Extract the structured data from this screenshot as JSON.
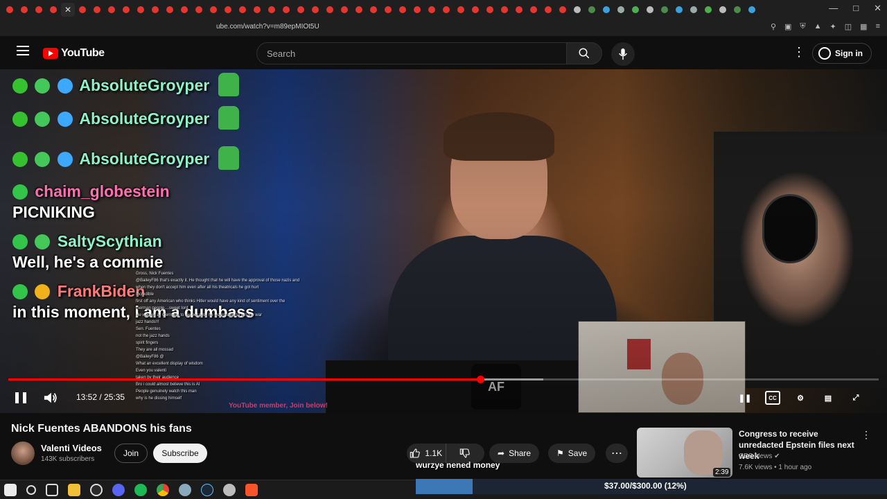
{
  "browser": {
    "url": "ube.com/watch?v=m89epMIOt5U"
  },
  "header": {
    "logo_text": "YouTube",
    "search_placeholder": "Search",
    "sign_in_label": "Sign in"
  },
  "chat": {
    "messages": [
      {
        "user": "AbsoluteGroyper",
        "text": ""
      },
      {
        "user": "AbsoluteGroyper",
        "text": ""
      },
      {
        "user": "AbsoluteGroyper",
        "text": ""
      },
      {
        "user": "chaim_globestein",
        "text": "PICNIKING"
      },
      {
        "user": "SaltyScythian",
        "text": "Well, he's a commie"
      },
      {
        "user": "FrankBiden",
        "text": "in this moment, i am a dumbass"
      }
    ],
    "mini_lines": [
      "Gross, Nick Fuentes",
      "@BaileyF86 that's exactly it. He thought that he will have the approval of those nazis and",
      "when they don't accept him even after all his theatricals he got hurt",
      "Incredible",
      "first off any American who thinks Hitler would have any kind of sentiment over the",
      "German people....sweet lord",
      "He wanted all Germans to die because he wasn't able to win the war",
      "jazz hands!!!",
      "Sen. Fuentes",
      "not the jazz hands",
      "spirit fingers",
      "They are all mossad",
      "@BaileyF86 @",
      "What an excellent display of wisdom",
      "Even you valenti",
      "taken by their audience",
      "Bro i could almost believe this is AI",
      "People genuinely watch this man",
      "why is he dissing himself"
    ],
    "banner": "YouTube member, Join below!"
  },
  "player": {
    "current_time": "13:52",
    "duration": "25:35",
    "time_display": "13:52 / 25:35",
    "progress_fraction": 0.542,
    "mug_text": "AF"
  },
  "video": {
    "title": "Nick Fuentes ABANDONS his fans",
    "channel_name": "Valenti Videos",
    "subscribers": "143K subscribers",
    "join_label": "Join",
    "subscribe_label": "Subscribe",
    "likes": "1.1K",
    "share_label": "Share",
    "save_label": "Save"
  },
  "recommendation": {
    "title": "Congress to receive unredacted Epstein files next week",
    "channel": "CBS News",
    "views": "7.6K views",
    "age": "1 hour ago",
    "meta": "7.6K views • 1 hour ago",
    "duration": "2:39"
  },
  "overlay": {
    "donation_name": "wurzye nened money",
    "goal_text": "$37.00/$300.00 (12%)",
    "goal_fraction": 0.12
  },
  "colors": {
    "youtube_red": "#ff0000",
    "background": "#0f0f0f",
    "goal_fill": "#3c78b6"
  }
}
